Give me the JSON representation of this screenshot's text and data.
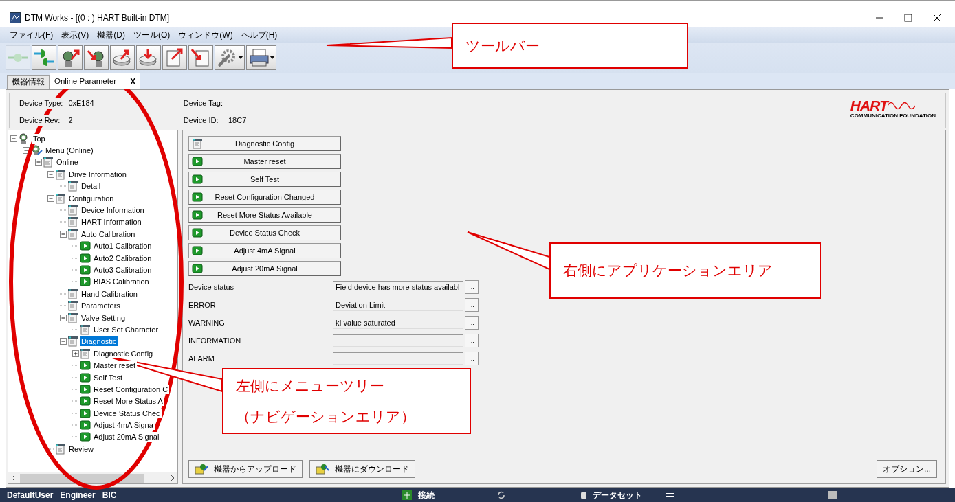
{
  "window": {
    "title": "DTM Works - [(0 : ) HART Built-in DTM]"
  },
  "menu": [
    "ファイル(F)",
    "表示(V)",
    "機器(D)",
    "ツール(O)",
    "ウィンドウ(W)",
    "ヘルプ(H)"
  ],
  "toolbar": [
    {
      "kind": "connect",
      "disabled": true,
      "dropdown": false
    },
    {
      "kind": "disconnect",
      "disabled": false,
      "dropdown": false
    },
    {
      "kind": "device_upload",
      "disabled": false,
      "dropdown": false
    },
    {
      "kind": "device_download",
      "disabled": false,
      "dropdown": false
    },
    {
      "kind": "disk_upload",
      "disabled": false,
      "dropdown": false
    },
    {
      "kind": "disk_download",
      "disabled": false,
      "dropdown": false
    },
    {
      "kind": "doc_export",
      "disabled": false,
      "dropdown": false
    },
    {
      "kind": "doc_import",
      "disabled": false,
      "dropdown": false
    },
    {
      "kind": "settings",
      "disabled": false,
      "dropdown": true
    },
    {
      "kind": "print",
      "disabled": false,
      "dropdown": true
    }
  ],
  "tabs": [
    {
      "label": "機器情報",
      "selected": false,
      "close": false
    },
    {
      "label": "Online Parameter",
      "selected": true,
      "close": "X"
    }
  ],
  "device_info": [
    {
      "label": "Device Type:",
      "value": "0xE184"
    },
    {
      "label": "Device Tag:"
    },
    {
      "label": "Device Rev:",
      "value": "2"
    },
    {
      "label": "Device ID:",
      "value": "18C7"
    }
  ],
  "logo": {
    "name": "HART",
    "tagline": "COMMUNICATION FOUNDATION"
  },
  "tree": [
    {
      "label": "Top",
      "kind": "device",
      "selected": false,
      "expanded": true,
      "children": [
        {
          "label": "Menu (Online)",
          "kind": "menu",
          "selected": false,
          "expanded": true,
          "children": [
            {
              "label": "Online",
              "kind": "page",
              "selected": false,
              "expanded": true,
              "children": [
                {
                  "label": "Drive Information",
                  "kind": "page",
                  "selected": false,
                  "expanded": true,
                  "children": [
                    {
                      "label": "Detail",
                      "kind": "page",
                      "selected": false
                    }
                  ]
                },
                {
                  "label": "Configuration",
                  "kind": "page",
                  "selected": false,
                  "expanded": true,
                  "children": [
                    {
                      "label": "Device Information",
                      "kind": "page",
                      "selected": false
                    },
                    {
                      "label": "HART Information",
                      "kind": "page",
                      "selected": false
                    },
                    {
                      "label": "Auto Calibration",
                      "kind": "page",
                      "selected": false,
                      "expanded": true,
                      "children": [
                        {
                          "label": "Auto1 Calibration",
                          "kind": "method",
                          "selected": false
                        },
                        {
                          "label": "Auto2 Calibration",
                          "kind": "method",
                          "selected": false
                        },
                        {
                          "label": "Auto3 Calibration",
                          "kind": "method",
                          "selected": false
                        },
                        {
                          "label": "BIAS Calibration",
                          "kind": "method",
                          "selected": false
                        }
                      ]
                    },
                    {
                      "label": "Hand Calibration",
                      "kind": "page",
                      "selected": false
                    },
                    {
                      "label": "Parameters",
                      "kind": "page",
                      "selected": false
                    },
                    {
                      "label": "Valve Setting",
                      "kind": "page",
                      "selected": false,
                      "expanded": true,
                      "children": [
                        {
                          "label": "User Set Character",
                          "kind": "page",
                          "selected": false
                        }
                      ]
                    },
                    {
                      "label": "Diagnostic",
                      "kind": "page",
                      "selected": true,
                      "expanded": true,
                      "children": [
                        {
                          "label": "Diagnostic Config",
                          "kind": "page",
                          "selected": false,
                          "expanded": false
                        },
                        {
                          "label": "Master reset",
                          "kind": "method",
                          "selected": false
                        },
                        {
                          "label": "Self Test",
                          "kind": "method",
                          "selected": false
                        },
                        {
                          "label": "Reset Configuration C",
                          "kind": "method",
                          "selected": false
                        },
                        {
                          "label": "Reset More Status A",
                          "kind": "method",
                          "selected": false
                        },
                        {
                          "label": "Device Status Chec",
                          "kind": "method",
                          "selected": false
                        },
                        {
                          "label": "Adjust 4mA Signa",
                          "kind": "method",
                          "selected": false
                        },
                        {
                          "label": "Adjust 20mA Signal",
                          "kind": "method",
                          "selected": false
                        }
                      ]
                    }
                  ]
                },
                {
                  "label": "Review",
                  "kind": "page",
                  "selected": false
                }
              ]
            }
          ]
        }
      ]
    }
  ],
  "actions": [
    {
      "label": "Diagnostic Config",
      "kind": "page"
    },
    {
      "label": "Master reset",
      "kind": "method"
    },
    {
      "label": "Self Test",
      "kind": "method"
    },
    {
      "label": "Reset Configuration Changed",
      "kind": "method"
    },
    {
      "label": "Reset More Status Available",
      "kind": "method"
    },
    {
      "label": "Device Status Check",
      "kind": "method"
    },
    {
      "label": "Adjust 4mA Signal",
      "kind": "method"
    },
    {
      "label": "Adjust 20mA Signal",
      "kind": "method"
    }
  ],
  "status_fields": [
    {
      "label": "Device status",
      "value": "Field device has more status availabl",
      "button": "..."
    },
    {
      "label": "ERROR",
      "value": "Deviation Limit",
      "button": "..."
    },
    {
      "label": "WARNING",
      "value": "kI value saturated",
      "button": "..."
    },
    {
      "label": "INFORMATION",
      "button": "..."
    },
    {
      "label": "ALARM",
      "button": "..."
    }
  ],
  "bottom_buttons": [
    {
      "label": "機器からアップロード",
      "kind": "upload"
    },
    {
      "label": "機器にダウンロード",
      "kind": "download"
    },
    {
      "label": "オプション...",
      "kind": "plain"
    }
  ],
  "status_bar": {
    "user": "DefaultUser",
    "role": "Engineer",
    "group": "BIC",
    "connection": "接続",
    "dataset": "データセット"
  },
  "annotations": [
    {
      "kind": "ellipse"
    },
    {
      "kind": "callout",
      "lines": [
        "ツールバー"
      ]
    },
    {
      "kind": "callout",
      "lines": [
        "右側にアプリケーションエリア"
      ]
    },
    {
      "kind": "callout",
      "lines": [
        "左側にメニューツリー",
        "（ナビゲーションエリア）"
      ]
    }
  ]
}
